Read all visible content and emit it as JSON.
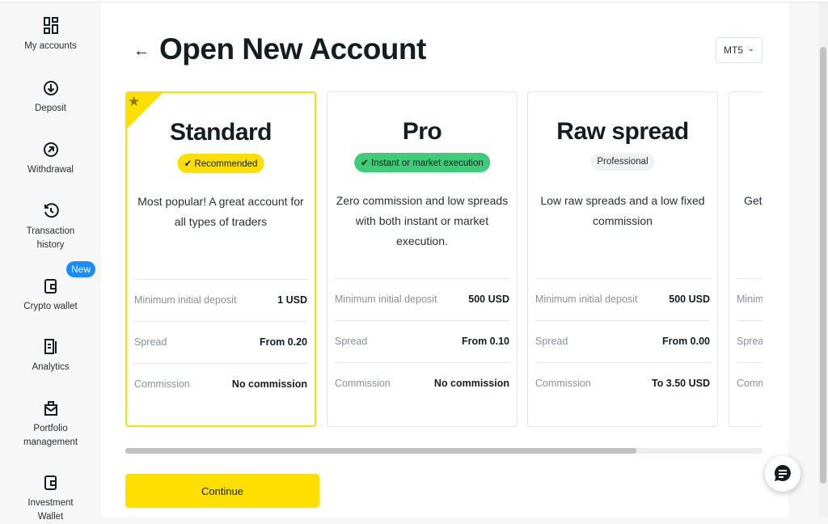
{
  "sidebar": {
    "items": [
      {
        "label": "My accounts",
        "icon": "grid-icon"
      },
      {
        "label": "Deposit",
        "icon": "arrow-down-circle-icon"
      },
      {
        "label": "Withdrawal",
        "icon": "arrow-up-right-circle-icon"
      },
      {
        "label": "Transaction history",
        "icon": "history-icon"
      },
      {
        "label": "Crypto wallet",
        "icon": "wallet-icon",
        "badge": "New"
      },
      {
        "label": "Analytics",
        "icon": "document-icon"
      },
      {
        "label": "Portfolio management",
        "icon": "briefcase-icon"
      },
      {
        "label": "Investment Wallet",
        "icon": "wallet-icon"
      }
    ]
  },
  "header": {
    "title": "Open New Account",
    "platform": "MT5"
  },
  "cards": [
    {
      "name": "Standard",
      "tag": "Recommended",
      "tag_color": "#ffde02",
      "desc": "Most popular! A great account for all types of traders",
      "rows": [
        [
          "Minimum initial deposit",
          "1 USD"
        ],
        [
          "Spread",
          "From 0.20"
        ],
        [
          "Commission",
          "No commission"
        ]
      ]
    },
    {
      "name": "Pro",
      "tag": "Instant or market execution",
      "tag_color": "#3fcc78",
      "desc": "Zero commission and low spreads with both instant or market execution.",
      "rows": [
        [
          "Minimum initial deposit",
          "500 USD"
        ],
        [
          "Spread",
          "From 0.10"
        ],
        [
          "Commission",
          "No commission"
        ]
      ]
    },
    {
      "name": "Raw spread",
      "tag": "Professional",
      "tag_color": "#f0f1f2",
      "desc": "Low raw spreads and a low fixed commission",
      "rows": [
        [
          "Minimum initial deposit",
          "500 USD"
        ],
        [
          "Spread",
          "From 0.00"
        ],
        [
          "Commission",
          "To 3.50 USD"
        ]
      ]
    },
    {
      "name": "",
      "tag": "",
      "desc": "Get",
      "rows": [
        [
          "Minimum",
          ""
        ],
        [
          "Spread",
          ""
        ],
        [
          "Commission",
          ""
        ]
      ]
    }
  ],
  "continue_label": "Continue",
  "accent": "#ffde02"
}
